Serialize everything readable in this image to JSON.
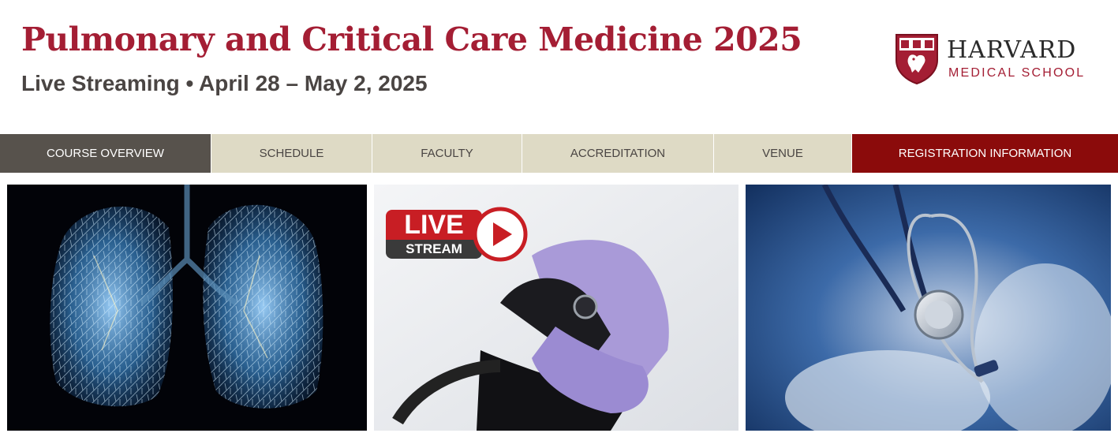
{
  "header": {
    "title": "Pulmonary and Critical Care Medicine 2025",
    "subtitle": "Live Streaming • April 28 – May 2, 2025"
  },
  "logo": {
    "name": "HARVARD",
    "school": "MEDICAL SCHOOL"
  },
  "nav": {
    "items": [
      {
        "label": "COURSE OVERVIEW",
        "active": true
      },
      {
        "label": "SCHEDULE"
      },
      {
        "label": "FACULTY"
      },
      {
        "label": "ACCREDITATION"
      },
      {
        "label": "VENUE"
      },
      {
        "label": "REGISTRATION INFORMATION",
        "highlight": true
      }
    ]
  },
  "banner": {
    "live_badge": {
      "top": "LIVE",
      "bottom": "STREAM"
    }
  },
  "colors": {
    "brand_crimson": "#a41e34",
    "nav_active": "#57524c",
    "nav_default": "#dedac5",
    "nav_cta": "#8b0b0b",
    "subtitle_gray": "#4a4543"
  },
  "icons": [
    "harvard-shield-icon",
    "play-icon"
  ]
}
